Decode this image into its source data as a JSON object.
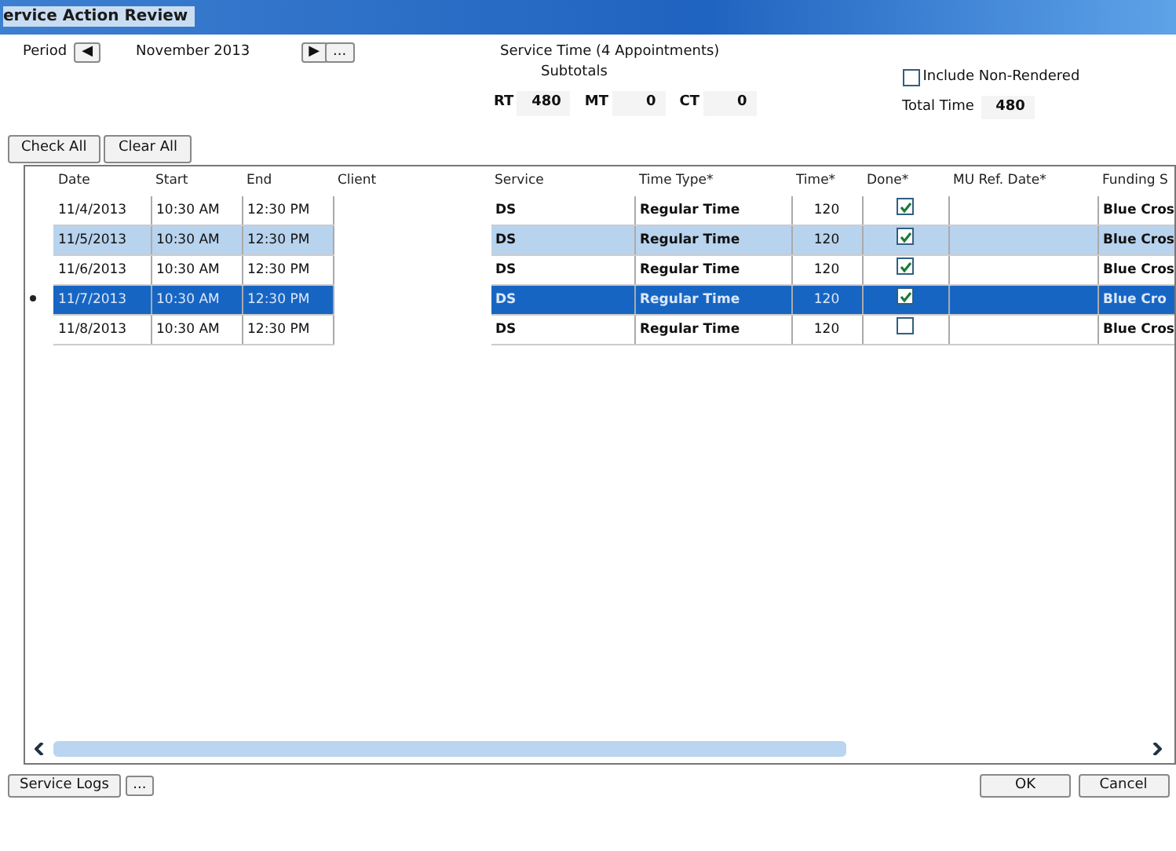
{
  "window": {
    "title": "ervice Action Review"
  },
  "period": {
    "label": "Period",
    "value": "November 2013",
    "prev": "◀",
    "next": "▶",
    "more": "..."
  },
  "service_time": {
    "title": "Service Time (4 Appointments)",
    "subtitle": "Subtotals",
    "fields": [
      {
        "label": "RT",
        "value": "480"
      },
      {
        "label": "MT",
        "value": "0"
      },
      {
        "label": "CT",
        "value": "0"
      }
    ]
  },
  "include_non_rendered": {
    "label": "Include Non-Rendered",
    "checked": false
  },
  "total_time": {
    "label": "Total Time",
    "value": "480"
  },
  "buttons_top": [
    "Check All",
    "Clear All"
  ],
  "table": {
    "columns": [
      "Date",
      "Start",
      "End",
      "Client",
      "Service",
      "Time Type*",
      "Time*",
      "Done*",
      "MU Ref. Date*",
      "Funding S"
    ],
    "rows": [
      {
        "date": "11/4/2013",
        "start": "10:30 AM",
        "end": "12:30 PM",
        "service": "DS",
        "time_type": "Regular Time",
        "time": "120",
        "done": true,
        "funding": "Blue Cros",
        "highlighted": false,
        "selected": false
      },
      {
        "date": "11/5/2013",
        "start": "10:30 AM",
        "end": "12:30 PM",
        "service": "DS",
        "time_type": "Regular Time",
        "time": "120",
        "done": true,
        "funding": "Blue Cros",
        "highlighted": true,
        "selected": false
      },
      {
        "date": "11/6/2013",
        "start": "10:30 AM",
        "end": "12:30 PM",
        "service": "DS",
        "time_type": "Regular Time",
        "time": "120",
        "done": true,
        "funding": "Blue Cros",
        "highlighted": false,
        "selected": false
      },
      {
        "date": "11/7/2013",
        "start": "10:30 AM",
        "end": "12:30 PM",
        "service": "DS",
        "time_type": "Regular Time",
        "time": "120",
        "done": true,
        "funding": "Blue Cro",
        "highlighted": false,
        "selected": true
      },
      {
        "date": "11/8/2013",
        "start": "10:30 AM",
        "end": "12:30 PM",
        "service": "DS",
        "time_type": "Regular Time",
        "time": "120",
        "done": false,
        "funding": "Blue Cros",
        "highlighted": false,
        "selected": false
      }
    ]
  },
  "bottom": {
    "service_logs": "Service Logs",
    "more": "...",
    "ok": "OK",
    "cancel": "Cancel"
  }
}
